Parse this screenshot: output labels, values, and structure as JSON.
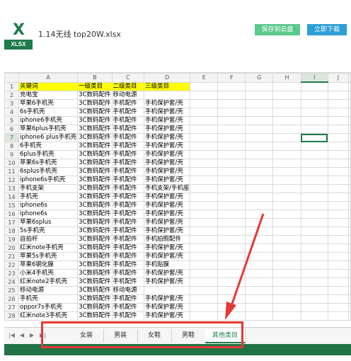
{
  "header": {
    "icon_letter": "X",
    "icon_tag": "XLSX",
    "file_name": "1.14无线 top20W.xlsx",
    "save_label": "保存到云盘",
    "download_label": "立即下载"
  },
  "grid": {
    "columns": [
      "A",
      "B",
      "C",
      "D",
      "E",
      "F",
      "G",
      "H",
      "I",
      "J"
    ],
    "selected_column": "I",
    "selected_row": 7,
    "rows": [
      [
        "关键词",
        "一级类目",
        "二级类目",
        "三级类目"
      ],
      [
        "充电宝",
        "3C数码配件",
        "移动电源",
        ""
      ],
      [
        "苹果6手机壳",
        "3C数码配件",
        "手机配件",
        "手机保护套/壳"
      ],
      [
        "6s手机壳",
        "3C数码配件",
        "手机配件",
        "手机保护套/壳"
      ],
      [
        "iphone6手机壳",
        "3C数码配件",
        "手机配件",
        "手机保护套/壳"
      ],
      [
        "苹果6plus手机壳",
        "3C数码配件",
        "手机配件",
        "手机保护套/壳"
      ],
      [
        "iphone6 plus手机壳",
        "3C数码配件",
        "手机配件",
        "手机保护套/壳"
      ],
      [
        "6手机壳",
        "3C数码配件",
        "手机配件",
        "手机保护套/壳"
      ],
      [
        "6plus手机壳",
        "3C数码配件",
        "手机配件",
        "手机保护套/壳"
      ],
      [
        "苹果6s手机壳",
        "3C数码配件",
        "手机配件",
        "手机保护套/壳"
      ],
      [
        "6splus手机壳",
        "3C数码配件",
        "手机配件",
        "手机保护套/壳"
      ],
      [
        "iphone6s手机壳",
        "3C数码配件",
        "手机配件",
        "手机保护套/壳"
      ],
      [
        "手机支架",
        "3C数码配件",
        "手机配件",
        "手机支架/手机座"
      ],
      [
        "手机壳",
        "3C数码配件",
        "手机配件",
        "手机保护套/壳"
      ],
      [
        "iphone6s",
        "3C数码配件",
        "手机配件",
        "手机保护套/壳"
      ],
      [
        "iphone6s",
        "3C数码配件",
        "手机配件",
        "手机保护套/壳"
      ],
      [
        "苹果6splus",
        "3C数码配件",
        "手机配件",
        "手机保护套/壳"
      ],
      [
        "5s手机壳",
        "3C数码配件",
        "手机配件",
        "手机保护套/壳"
      ],
      [
        "自拍杆",
        "3C数码配件",
        "手机配件",
        "手机拍照配件"
      ],
      [
        "红米note手机壳",
        "3C数码配件",
        "手机配件",
        "手机保护套/壳"
      ],
      [
        "苹果5s手机壳",
        "3C数码配件",
        "手机配件",
        "手机保护套/壳"
      ],
      [
        "苹果6钢化膜",
        "3C数码配件",
        "手机配件",
        "手机贴膜"
      ],
      [
        "小米4手机壳",
        "3C数码配件",
        "手机配件",
        "手机保护套/壳"
      ],
      [
        "红米note2手机壳",
        "3C数码配件",
        "手机配件",
        "手机保护套/壳"
      ],
      [
        "移动电源",
        "3C数码配件",
        "移动电源",
        ""
      ],
      [
        "手机壳",
        "3C数码配件",
        "手机配件",
        "手机保护套/壳"
      ],
      [
        "oppor7s手机壳",
        "3C数码配件",
        "手机配件",
        "手机保护套/壳"
      ],
      [
        "红米note3手机壳",
        "3C数码配件",
        "手机配件",
        "手机保护套/壳"
      ]
    ]
  },
  "tabs": {
    "items": [
      "女装",
      "男装",
      "女鞋",
      "男鞋",
      "其他类目"
    ],
    "active_index": 4
  },
  "colors": {
    "brand_green": "#217346",
    "header_yellow": "#ffff00",
    "annotation_red": "#e53935"
  }
}
